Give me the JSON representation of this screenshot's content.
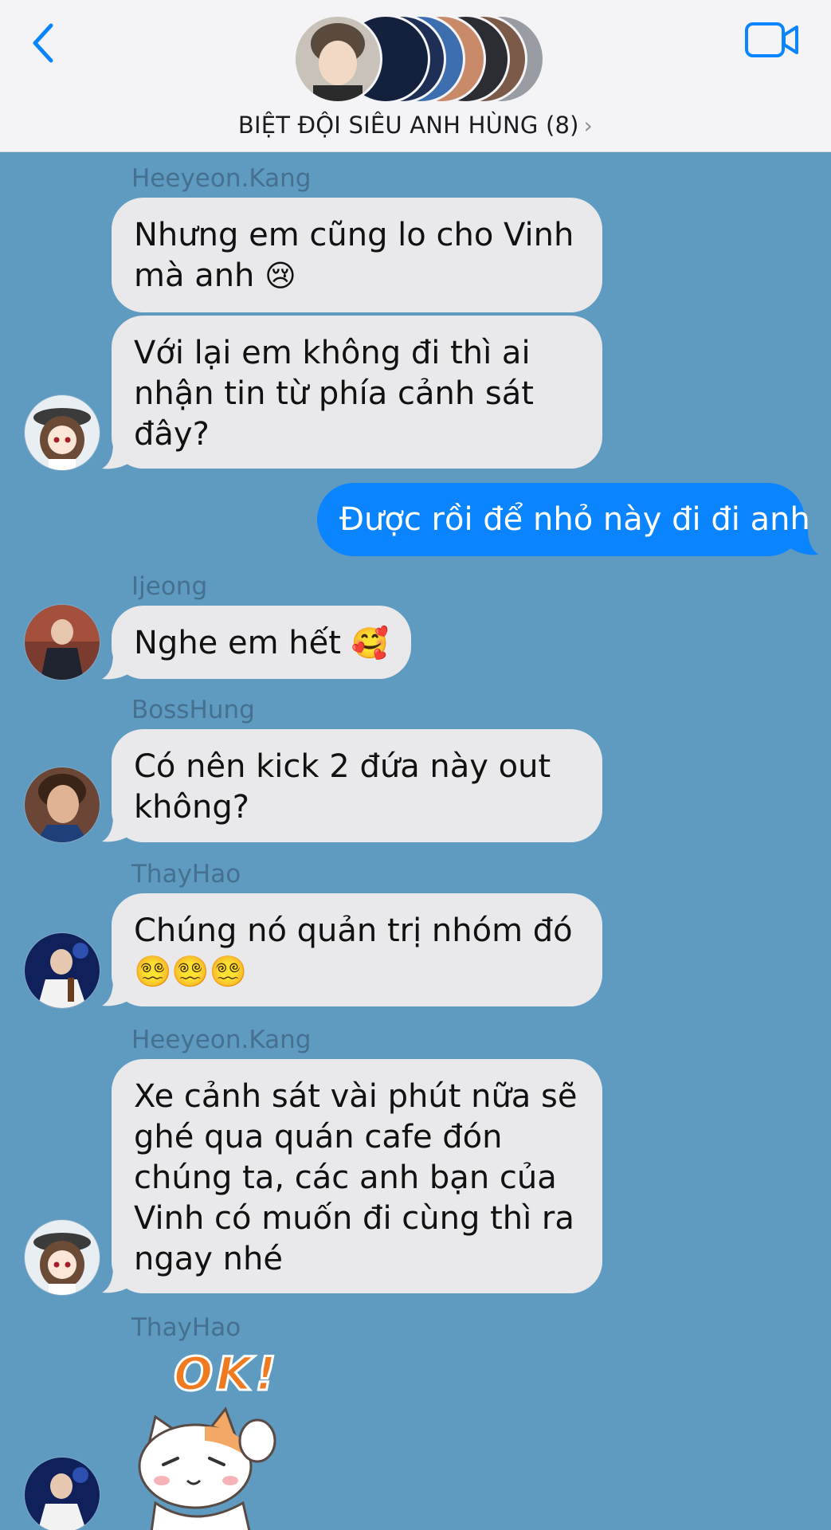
{
  "header": {
    "group_title": "BIỆT ĐỘI SIÊU ANH HÙNG (8)",
    "chevron": "›",
    "back_icon": "chevron-left-icon",
    "video_icon": "video-camera-icon",
    "accent_color": "#0a84ff"
  },
  "messages": [
    {
      "sender": "Heeyeon.Kang",
      "text": "Nhưng em cũng lo cho Vinh mà anh",
      "emoji": "😢"
    },
    {
      "text": "Với lại em không đi thì ai nhận tin từ phía cảnh sát đây?"
    },
    {
      "outgoing": true,
      "text": "Được rồi để nhỏ này đi đi anh"
    },
    {
      "sender": "Ijeong",
      "text": "Nghe em hết",
      "emoji": "🥰"
    },
    {
      "sender": "BossHung",
      "text": "Có nên kick 2 đứa này out không?"
    },
    {
      "sender": "ThayHao",
      "text": "Chúng nó quản trị nhóm đó",
      "emoji": "😵‍💫😵‍💫😵‍💫"
    },
    {
      "sender": "Heeyeon.Kang",
      "text": "Xe cảnh sát vài phút nữa sẽ ghé qua quán cafe đón chúng ta, các anh bạn của Vinh có muốn đi cùng thì ra ngay nhé"
    },
    {
      "sender": "ThayHao",
      "sticker": "cat-ok-sticker",
      "sticker_text": "OK!"
    }
  ],
  "colors": {
    "chat_background": "#5f9bc0",
    "incoming_bubble": "#e9e9eb",
    "outgoing_bubble": "#0a84ff",
    "header_background": "#f4f4f7"
  }
}
